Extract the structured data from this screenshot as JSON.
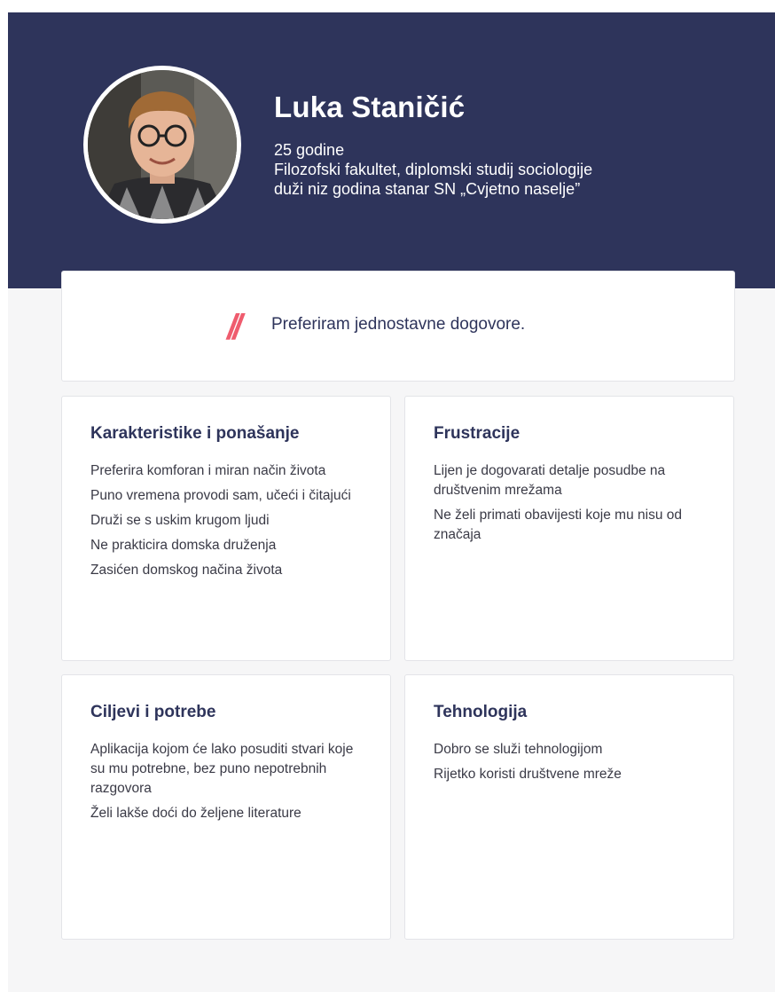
{
  "persona": {
    "name": "Luka Staničić",
    "details": [
      "25 godine",
      "Filozofski fakultet, diplomski studij sociologije",
      "duži niz godina stanar SN „Cvjetno naselje”"
    ]
  },
  "quote": {
    "mark": "//",
    "text": "Preferiram jednostavne dogovore."
  },
  "sections": [
    {
      "title": "Karakteristike i ponašanje",
      "items": [
        "Preferira komforan i miran način života",
        "Puno vremena provodi sam, učeći i čitajući",
        "Druži se s uskim krugom ljudi",
        "Ne prakticira domska druženja",
        "Zasićen domskog načina života"
      ]
    },
    {
      "title": "Frustracije",
      "items": [
        "Lijen je dogovarati detalje posudbe na društvenim mrežama",
        "Ne želi primati obavijesti koje mu nisu od značaja"
      ]
    },
    {
      "title": "Ciljevi i potrebe",
      "items": [
        "Aplikacija kojom će lako posuditi stvari koje su mu potrebne, bez puno nepotrebnih razgovora",
        "Želi lakše doći do željene literature"
      ]
    },
    {
      "title": "Tehnologija",
      "items": [
        "Dobro se služi tehnologijom",
        "Rijetko koristi društvene mreže"
      ]
    }
  ],
  "colors": {
    "header_bg": "#2e345b",
    "accent": "#ef5c6e",
    "page_bg": "#f6f6f7"
  }
}
